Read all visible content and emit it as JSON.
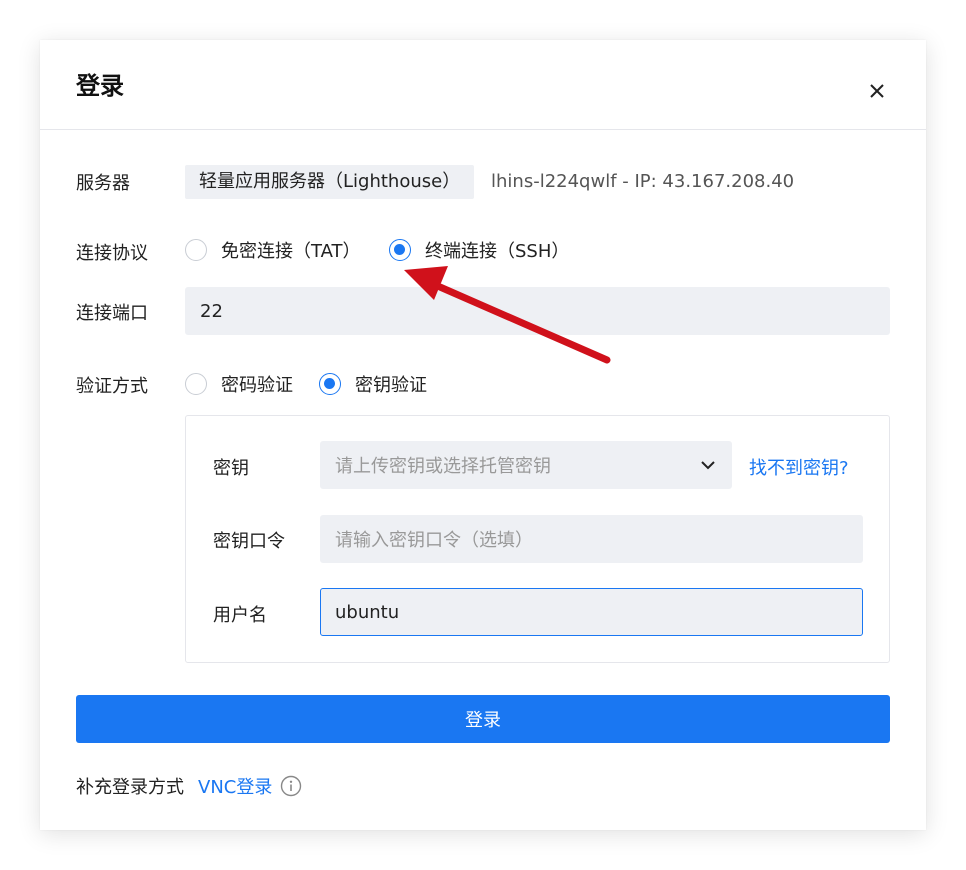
{
  "dialog": {
    "title": "登录",
    "close_icon": "close-icon"
  },
  "server": {
    "label": "服务器",
    "type_tag": "轻量应用服务器（Lighthouse）",
    "info": "lhins-l224qwlf - IP: 43.167.208.40"
  },
  "protocol": {
    "label": "连接协议",
    "options": [
      {
        "label": "免密连接（TAT）",
        "checked": false
      },
      {
        "label": "终端连接（SSH）",
        "checked": true
      }
    ]
  },
  "port": {
    "label": "连接端口",
    "value": "22"
  },
  "auth": {
    "label": "验证方式",
    "options": [
      {
        "label": "密码验证",
        "checked": false
      },
      {
        "label": "密钥验证",
        "checked": true
      }
    ],
    "key": {
      "label": "密钥",
      "placeholder": "请上传密钥或选择托管密钥",
      "help_link": "找不到密钥?"
    },
    "passphrase": {
      "label": "密钥口令",
      "placeholder": "请输入密钥口令（选填）"
    },
    "username": {
      "label": "用户名",
      "value": "ubuntu"
    }
  },
  "submit_label": "登录",
  "footer": {
    "label": "补充登录方式",
    "vnc_link": "VNC登录",
    "info_icon": "info-icon"
  },
  "colors": {
    "accent": "#1a77f2",
    "annotation_arrow": "#d0111b"
  }
}
